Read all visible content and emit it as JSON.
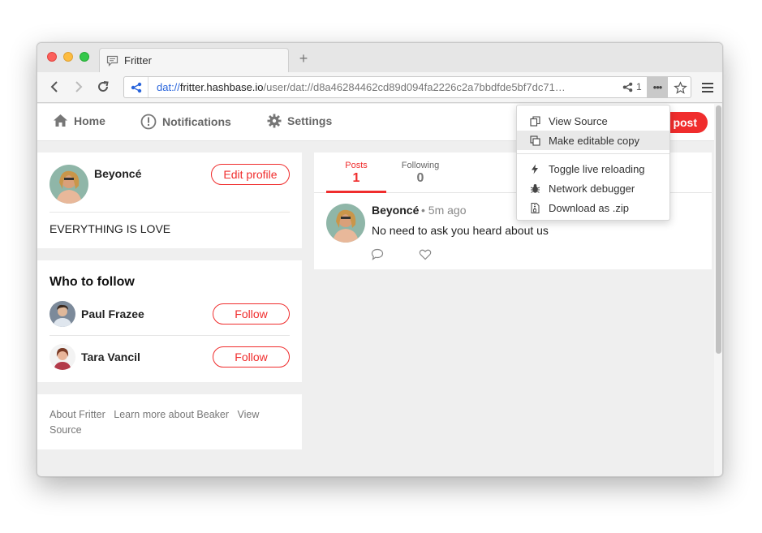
{
  "browser": {
    "tab_title": "Fritter",
    "new_tab_label": "+",
    "url": {
      "protocol": "dat://",
      "host": "fritter.hashbase.io",
      "path": "/user/dat://d8a46284462cd89d094fa2226c2a7bbdfde5bf7dc71…"
    },
    "peer_count": "1",
    "more_label": "•••"
  },
  "nav": {
    "home": "Home",
    "notifications": "Notifications",
    "settings": "Settings",
    "new_post": "post"
  },
  "profile": {
    "name": "Beyoncé",
    "edit_label": "Edit profile",
    "bio": "EVERYTHING IS LOVE"
  },
  "who_to_follow": {
    "title": "Who to follow",
    "users": [
      {
        "name": "Paul Frazee",
        "button": "Follow"
      },
      {
        "name": "Tara Vancil",
        "button": "Follow"
      }
    ]
  },
  "footer": {
    "links": [
      "About Fritter",
      "Learn more about Beaker",
      "View Source"
    ]
  },
  "feed": {
    "tabs": [
      {
        "label": "Posts",
        "count": "1"
      },
      {
        "label": "Following",
        "count": "0"
      }
    ],
    "post": {
      "author": "Beyoncé",
      "time": "• 5m ago",
      "text": "No need to ask you heard about us"
    }
  },
  "dropdown": {
    "items": [
      {
        "label": "View Source",
        "icon": "copy-icon"
      },
      {
        "label": "Make editable copy",
        "icon": "clone-icon"
      },
      {
        "label": "Toggle live reloading",
        "icon": "bolt-icon"
      },
      {
        "label": "Network debugger",
        "icon": "bug-icon"
      },
      {
        "label": "Download as .zip",
        "icon": "zip-file-icon"
      }
    ]
  },
  "colors": {
    "accent": "#f02d2d",
    "link_blue": "#2864dc"
  }
}
